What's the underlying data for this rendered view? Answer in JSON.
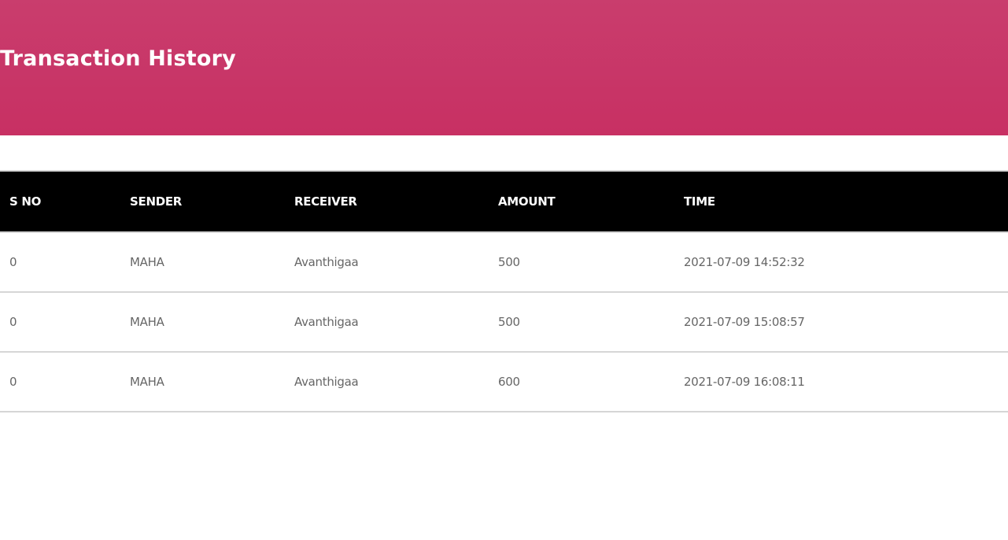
{
  "header": {
    "title": "Transaction History",
    "colors": {
      "from": "#c93d6d",
      "to": "#c83063"
    }
  },
  "table": {
    "columns": [
      "S NO",
      "SENDER",
      "RECEIVER",
      "AMOUNT",
      "TIME"
    ],
    "rows": [
      [
        "0",
        "MAHA",
        "Avanthigaa",
        "500",
        "2021-07-09 14:52:32"
      ],
      [
        "0",
        "MAHA",
        "Avanthigaa",
        "500",
        "2021-07-09 15:08:57"
      ],
      [
        "0",
        "MAHA",
        "Avanthigaa",
        "600",
        "2021-07-09 16:08:11"
      ]
    ],
    "colors": {
      "header_bg": "#000000",
      "header_text": "#ffffff",
      "cell_text": "#666666",
      "rule": "#d6d6d6"
    }
  }
}
